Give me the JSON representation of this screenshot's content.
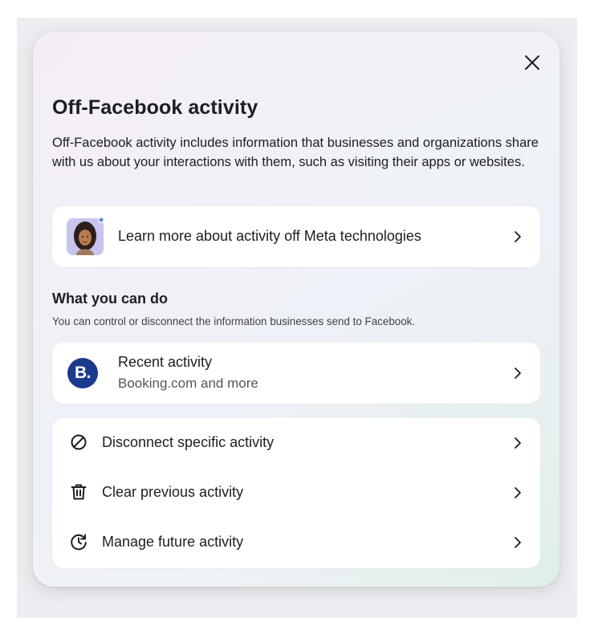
{
  "dialog": {
    "close_icon": "close-icon",
    "title": "Off-Facebook activity",
    "description": "Off-Facebook activity includes information that businesses and organizations share with us about your interactions with them, such as visiting their apps or websites."
  },
  "learn_more": {
    "label": "Learn more about activity off Meta technologies",
    "icon": "avatar-illustration"
  },
  "what_you_can_do": {
    "title": "What you can do",
    "description": "You can control or disconnect the information businesses send to Facebook."
  },
  "recent_activity": {
    "logo_text": "B.",
    "logo_color": "#1a3a8c",
    "label": "Recent activity",
    "sublabel": "Booking.com and more"
  },
  "actions": [
    {
      "label": "Disconnect specific activity",
      "icon": "disconnect-icon"
    },
    {
      "label": "Clear previous activity",
      "icon": "trash-icon"
    },
    {
      "label": "Manage future activity",
      "icon": "history-icon"
    }
  ]
}
